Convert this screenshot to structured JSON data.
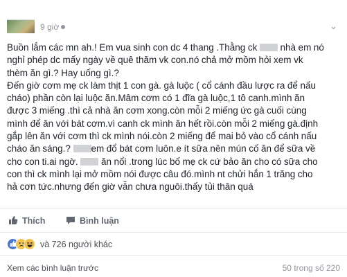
{
  "header": {
    "time": "9 giờ",
    "avatar_icon": "avatar-photo"
  },
  "post": {
    "lines": [
      [
        "Buồn lắm các mn ah.! Em vua sinh con dc 4 thang .Thằng ck",
        "nhà em nó"
      ],
      [
        "nghỉ phép dc mấy ngày về quê thăm vk con.nó chả mở mồm hỏi xem vk"
      ],
      [
        "thèm ăn gì.? Hay uống gì.?"
      ],
      [
        "Đến giờ cơm mẹ ck làm thịt 1 con gà. gà luộc ( cổ cánh đầu lược ra để nấu"
      ],
      [
        "cháo) phần còn lại luộc ăn.Mâm cơm có 1 đĩa gà luộc,1 tô canh.mình ăn"
      ],
      [
        "được 3 miếng .thì cả nhà ăn cơm xong.còn mỗi 2 miếng ức gà cuối cùng"
      ],
      [
        "mình để ăn với bát cơm.vì canh ck mình ăn hết rồi.còn mỗi 2 miếng gà.định"
      ],
      [
        "gắp lên ăn với cơm thì ck mình nói.còn 2 miếng để mai bỏ vào cổ cánh nấu"
      ],
      [
        "cháo ăn sáng.?",
        "em đổ bát cơm luôn.e ít sữa nên mún cố ăn để sữa về"
      ],
      [
        "cho con ti.ai ngờ.",
        "ăn nổi .trong lúc bố mẹ ck cứ bảo ăn cho có sữa cho"
      ],
      [
        "con thì ck mình lại mở mồm nói được câu đó.mình nt chửi hắn 1 trăng cho"
      ],
      [
        "hả cơn tức.nhưng đến giờ vẫn chưa nguôi.thấy tủi thân quá"
      ]
    ]
  },
  "actions": {
    "like_label": "Thích",
    "comment_label": "Bình luận"
  },
  "reactions": {
    "count_text": "và 726 người khác",
    "types": [
      "like-icon",
      "sad-icon",
      "haha-icon"
    ]
  },
  "comments": {
    "view_previous": "Xem các bình luận trước",
    "count": "50 trong số 220"
  },
  "colors": {
    "link_blue": "#4267b2",
    "muted": "#90949c",
    "text": "#1d2129"
  }
}
